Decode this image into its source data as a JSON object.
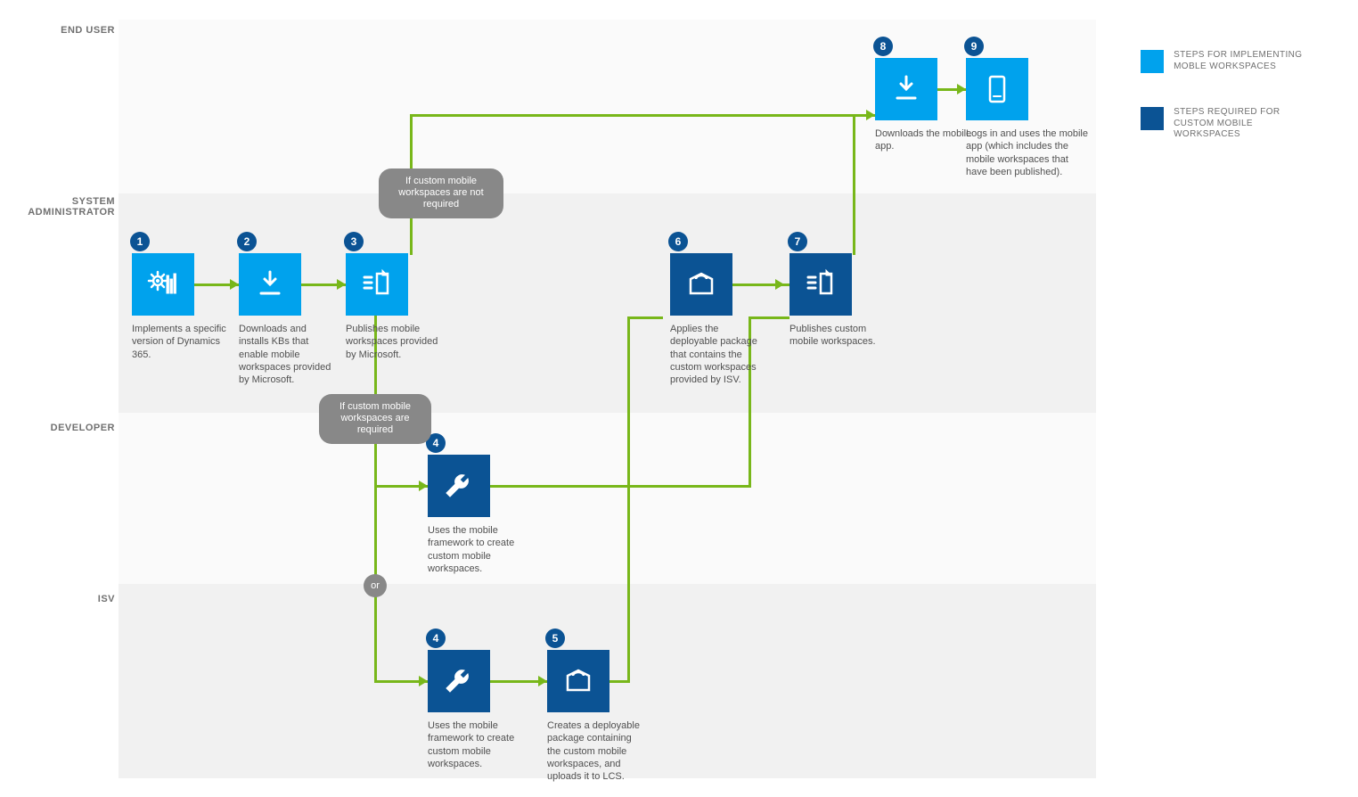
{
  "lanes": {
    "endUser": "END USER",
    "sysAdmin": "SYSTEM\nADMINISTRATOR",
    "developer": "Developer",
    "isv": "ISV"
  },
  "steps": {
    "s1": {
      "num": "1",
      "caption": "Implements a specific version of Dynamics 365."
    },
    "s2": {
      "num": "2",
      "caption": "Downloads and installs KBs that enable mobile workspaces provided by Microsoft."
    },
    "s3": {
      "num": "3",
      "caption": "Publishes mobile workspaces provided by Microsoft."
    },
    "s4a": {
      "num": "4",
      "caption": "Uses the mobile framework to create custom mobile workspaces."
    },
    "s4b": {
      "num": "4",
      "caption": "Uses the mobile framework to create custom mobile workspaces."
    },
    "s5": {
      "num": "5",
      "caption": "Creates a deployable package containing the custom mobile workspaces, and uploads it to LCS."
    },
    "s6": {
      "num": "6",
      "caption": "Applies the deployable package that contains the custom workspaces provided by ISV."
    },
    "s7": {
      "num": "7",
      "caption": "Publishes custom mobile workspaces."
    },
    "s8": {
      "num": "8",
      "caption": "Downloads the mobile app."
    },
    "s9": {
      "num": "9",
      "caption": "Logs in and uses the mobile app (which includes the mobile workspaces that have been published)."
    }
  },
  "conditions": {
    "notRequired": "If custom mobile workspaces are not required",
    "required": "If custom mobile workspaces are required",
    "or": "or"
  },
  "legend": {
    "item1": "STEPS FOR IMPLEMENTING MOBLE WORKSPACES",
    "item2": "STEPS REQUIRED FOR CUSTOM MOBILE WORKSPACES"
  },
  "chart_data": {
    "type": "flowchart",
    "swimlanes": [
      "END USER",
      "SYSTEM ADMINISTRATOR",
      "Developer",
      "ISV"
    ],
    "legend": [
      {
        "color": "#00a2ed",
        "label": "STEPS FOR IMPLEMENTING MOBLE WORKSPACES"
      },
      {
        "color": "#0b5394",
        "label": "STEPS REQUIRED FOR CUSTOM MOBILE WORKSPACES"
      }
    ],
    "nodes": [
      {
        "id": 1,
        "lane": "SYSTEM ADMINISTRATOR",
        "kind": "implement",
        "label": "Implements a specific version of Dynamics 365."
      },
      {
        "id": 2,
        "lane": "SYSTEM ADMINISTRATOR",
        "kind": "implement",
        "label": "Downloads and installs KBs that enable mobile workspaces provided by Microsoft."
      },
      {
        "id": 3,
        "lane": "SYSTEM ADMINISTRATOR",
        "kind": "implement",
        "label": "Publishes mobile workspaces provided by Microsoft."
      },
      {
        "id": "4-dev",
        "lane": "Developer",
        "kind": "custom",
        "label": "Uses the mobile framework to create custom mobile workspaces."
      },
      {
        "id": "4-isv",
        "lane": "ISV",
        "kind": "custom",
        "label": "Uses the mobile framework to create custom mobile workspaces."
      },
      {
        "id": 5,
        "lane": "ISV",
        "kind": "custom",
        "label": "Creates a deployable package containing the custom mobile workspaces, and uploads it to LCS."
      },
      {
        "id": 6,
        "lane": "SYSTEM ADMINISTRATOR",
        "kind": "custom",
        "label": "Applies the deployable package that contains the custom workspaces provided by ISV."
      },
      {
        "id": 7,
        "lane": "SYSTEM ADMINISTRATOR",
        "kind": "custom",
        "label": "Publishes custom mobile workspaces."
      },
      {
        "id": 8,
        "lane": "END USER",
        "kind": "implement",
        "label": "Downloads the mobile app."
      },
      {
        "id": 9,
        "lane": "END USER",
        "kind": "implement",
        "label": "Logs in and uses the mobile app (which includes the mobile workspaces that have been published)."
      }
    ],
    "edges": [
      {
        "from": 1,
        "to": 2
      },
      {
        "from": 2,
        "to": 3
      },
      {
        "from": 3,
        "to": 8,
        "condition": "If custom mobile workspaces are not required"
      },
      {
        "from": 3,
        "to": "4-dev",
        "condition": "If custom mobile workspaces are required"
      },
      {
        "from": 3,
        "to": "4-isv",
        "condition": "If custom mobile workspaces are required",
        "junction": "or"
      },
      {
        "from": "4-dev",
        "to": 7
      },
      {
        "from": "4-isv",
        "to": 5
      },
      {
        "from": 5,
        "to": 6
      },
      {
        "from": 6,
        "to": 7
      },
      {
        "from": 7,
        "to": 8
      },
      {
        "from": 8,
        "to": 9
      }
    ]
  }
}
